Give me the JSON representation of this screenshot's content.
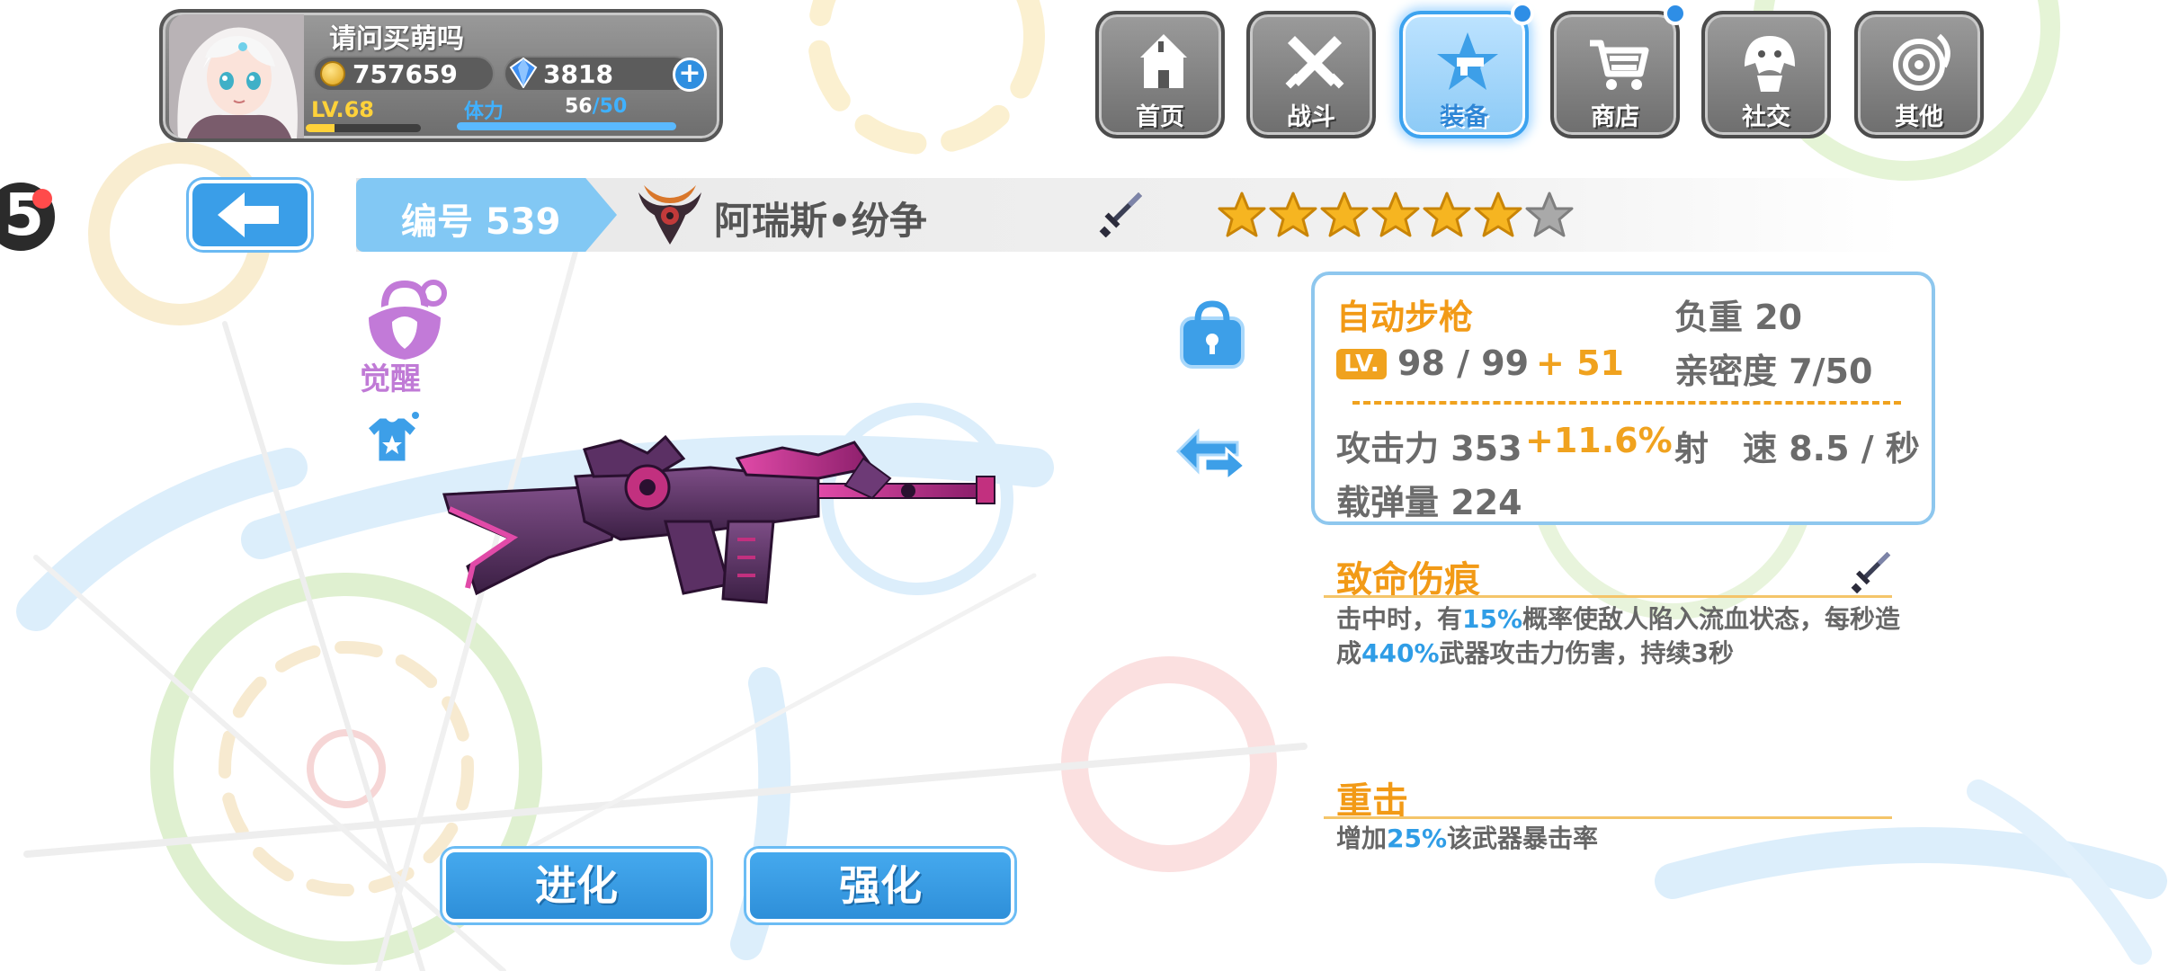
{
  "player": {
    "name": "请问买萌吗",
    "gold": "757659",
    "gems": "3818",
    "level_label": "LV.68",
    "level_progress": 0.25,
    "stamina_label": "体力",
    "stamina_current": "56",
    "stamina_max": "/50",
    "stamina_progress": 1.0
  },
  "nav": {
    "items": [
      {
        "label": "首页",
        "icon": "house-icon"
      },
      {
        "label": "战斗",
        "icon": "crossed-swords-icon"
      },
      {
        "label": "装备",
        "icon": "star-gun-icon",
        "active": true,
        "badge": true
      },
      {
        "label": "商店",
        "icon": "shopping-cart-icon",
        "badge": true
      },
      {
        "label": "社交",
        "icon": "friend-icon"
      },
      {
        "label": "其他",
        "icon": "spiral-icon"
      }
    ]
  },
  "edge_fragment": "5",
  "weapon": {
    "id_label": "编号 539",
    "name": "阿瑞斯•纷争",
    "stars_filled": 6,
    "stars_total": 7,
    "type": "自动步枪",
    "weight": "负重 20",
    "lv_badge": "LV.",
    "level": "98 / 99",
    "level_bonus": "+ 51",
    "affinity": "亲密度 7/50",
    "attack": "攻击力 353",
    "attack_bonus": "+11.6%",
    "fire_rate": "射　速 8.5 / 秒",
    "ammo": "载弹量 224"
  },
  "side_tools": {
    "awaken_label": "觉醒"
  },
  "skills": [
    {
      "title": "致命伤痕",
      "desc_parts": [
        "击中时，有",
        "15%",
        "概率使敌人陷入流血状态，每秒造成",
        "440%",
        "武器攻击力伤害，持续3秒"
      ]
    },
    {
      "title": "重击",
      "desc_parts": [
        "增加",
        "25%",
        "该武器暴击率"
      ]
    }
  ],
  "actions": {
    "evolve": "进化",
    "enhance": "强化"
  },
  "colors": {
    "accent_blue": "#3a9ee8",
    "accent_orange": "#f29a16",
    "highlight_blue": "#2f9de6",
    "weapon_purple": "#8a2a7e"
  }
}
